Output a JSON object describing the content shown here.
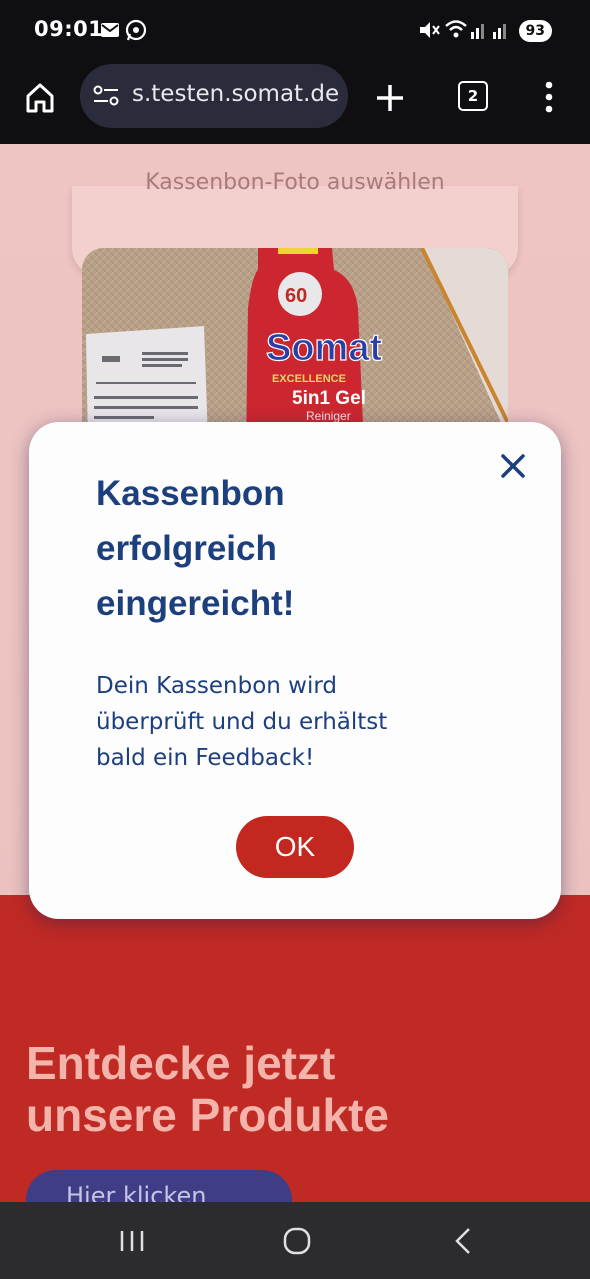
{
  "status_bar": {
    "time": "09:01",
    "battery": "93",
    "icons": [
      "mail-icon",
      "whatsapp-icon",
      "mute-icon",
      "wifi-icon",
      "signal-icon",
      "signal-icon"
    ]
  },
  "browser": {
    "url": "s.testen.somat.de",
    "tab_count": "2",
    "icons": [
      "home-icon",
      "site-settings-icon",
      "new-tab-icon",
      "tabs-icon",
      "more-icon"
    ]
  },
  "page": {
    "upload_button_label": "Kassenbon-Foto auswählen",
    "promo_title_line1": "Entdecke jetzt",
    "promo_title_line2": "unsere Produkte",
    "promo_button_label": "Hier klicken"
  },
  "modal": {
    "title_line1": "Kassenbon",
    "title_line2": "erfolgreich",
    "title_line3": "eingereicht!",
    "body_line1": "Dein Kassenbon wird",
    "body_line2": "überprüft und du erhältst",
    "body_line3": "bald ein Feedback!",
    "ok_label": "OK"
  },
  "photo": {
    "bottle_badge": "60",
    "bottle_brand": "Somat",
    "bottle_line": "EXCELLENCE",
    "bottle_product": "5in1 Gel",
    "bottle_sub": "Reiniger"
  },
  "colors": {
    "accent_red": "#c2281f",
    "modal_text": "#1c3f7e",
    "promo_purple": "#3f3d86"
  }
}
